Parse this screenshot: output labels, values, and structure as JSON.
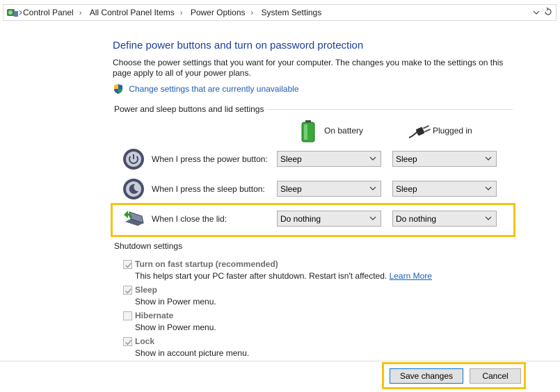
{
  "address_bar": {
    "crumbs": [
      "Control Panel",
      "All Control Panel Items",
      "Power Options",
      "System Settings"
    ]
  },
  "page": {
    "title": "Define power buttons and turn on password protection",
    "description": "Choose the power settings that you want for your computer. The changes you make to the settings on this page apply to all of your power plans.",
    "change_link": "Change settings that are currently unavailable"
  },
  "power_section": {
    "heading": "Power and sleep buttons and lid settings",
    "col_battery": "On battery",
    "col_plugged": "Plugged in",
    "rows": [
      {
        "label": "When I press the power button:",
        "battery": "Sleep",
        "plugged": "Sleep"
      },
      {
        "label": "When I press the sleep button:",
        "battery": "Sleep",
        "plugged": "Sleep"
      },
      {
        "label": "When I close the lid:",
        "battery": "Do nothing",
        "plugged": "Do nothing"
      }
    ]
  },
  "shutdown_section": {
    "heading": "Shutdown settings",
    "options": [
      {
        "title": "Turn on fast startup (recommended)",
        "desc": "This helps start your PC faster after shutdown. Restart isn't affected.",
        "link": "Learn More",
        "checked": true
      },
      {
        "title": "Sleep",
        "desc": "Show in Power menu.",
        "checked": true
      },
      {
        "title": "Hibernate",
        "desc": "Show in Power menu.",
        "checked": false
      },
      {
        "title": "Lock",
        "desc": "Show in account picture menu.",
        "checked": true
      }
    ]
  },
  "buttons": {
    "save": "Save changes",
    "cancel": "Cancel"
  },
  "colors": {
    "title": "#1a3e9e",
    "link": "#1a5fb4",
    "highlight": "#f6c313"
  }
}
